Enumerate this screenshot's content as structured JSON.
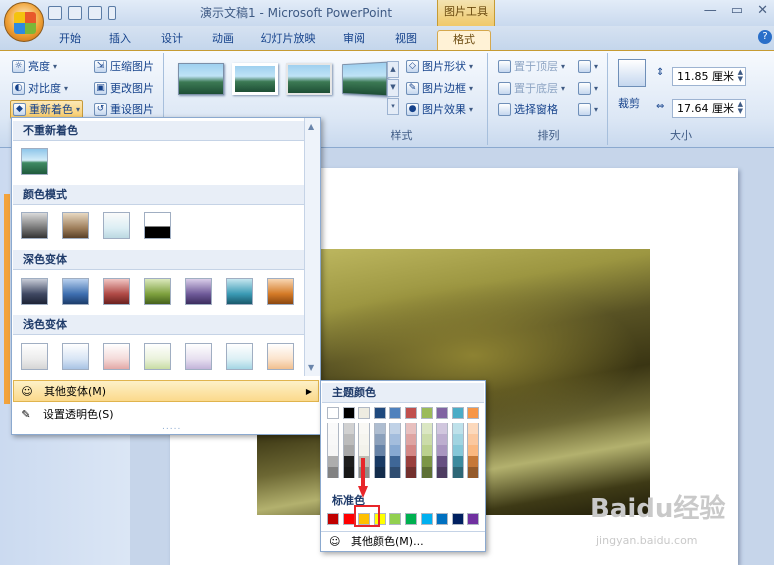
{
  "window": {
    "title": "演示文稿1 - Microsoft PowerPoint",
    "context_tools": "图片工具",
    "controls": [
      "—",
      "▭",
      "✕"
    ]
  },
  "qat": {
    "icons": [
      "save-icon",
      "undo-icon",
      "redo-icon",
      "customize-icon"
    ]
  },
  "tabs": [
    "开始",
    "插入",
    "设计",
    "动画",
    "幻灯片放映",
    "审阅",
    "视图",
    "格式"
  ],
  "active_tab": "格式",
  "ribbon": {
    "adjust": {
      "brightness": "亮度",
      "contrast": "对比度",
      "recolor": "重新着色",
      "compress": "压缩图片",
      "change": "更改图片",
      "reset": "重设图片"
    },
    "styles": {
      "label": "样式",
      "shape": "图片形状",
      "border": "图片边框",
      "effects": "图片效果"
    },
    "arrange": {
      "label": "排列",
      "front": "置于顶层",
      "back": "置于底层",
      "pane": "选择窗格"
    },
    "size": {
      "label": "大小",
      "crop": "裁剪",
      "height": "11.85 厘米",
      "width": "17.64 厘米"
    }
  },
  "recolor_menu": {
    "no_recolor": "不重新着色",
    "color_modes": "颜色模式",
    "dark_variants": "深色变体",
    "light_variants": "浅色变体",
    "more_variants": "其他变体(M)",
    "set_transparent": "设置透明色(S)",
    "grip": "....."
  },
  "color_menu": {
    "theme_colors": "主题颜色",
    "standard_colors": "标准色",
    "more_colors": "其他颜色(M)...",
    "theme_row": [
      "#ffffff",
      "#000000",
      "#eeece1",
      "#1f497d",
      "#4f81bd",
      "#c0504d",
      "#9bbb59",
      "#8064a2",
      "#4bacc6",
      "#f79646"
    ],
    "standard_row": [
      "#c00000",
      "#ff0000",
      "#ffc000",
      "#ffff00",
      "#92d050",
      "#00b050",
      "#00b0f0",
      "#0070c0",
      "#002060",
      "#7030a0"
    ]
  },
  "watermark": {
    "text": "Baidu经验",
    "sub": "jingyan.baidu.com"
  }
}
